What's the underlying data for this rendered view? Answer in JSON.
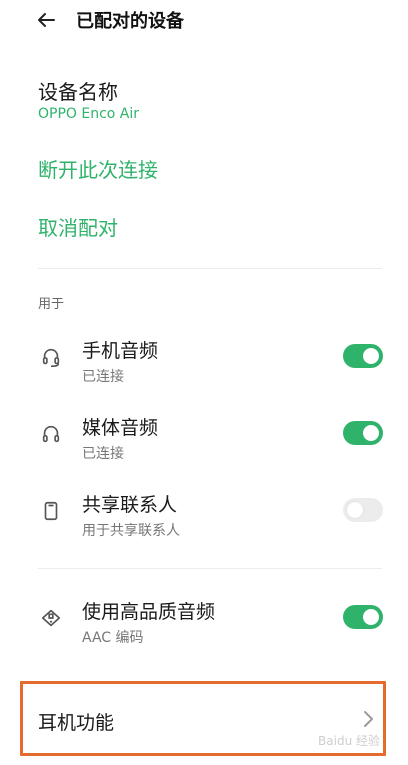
{
  "header": {
    "title": "已配对的设备",
    "back_icon": "arrow-left-icon"
  },
  "device": {
    "label": "设备名称",
    "value": "OPPO Enco Air"
  },
  "actions": {
    "disconnect": "断开此次连接",
    "unpair": "取消配对"
  },
  "section": {
    "label": "用于"
  },
  "rows": [
    {
      "title": "手机音频",
      "subtitle": "已连接",
      "icon": "headset-icon",
      "enabled": true
    },
    {
      "title": "媒体音频",
      "subtitle": "已连接",
      "icon": "headphones-icon",
      "enabled": true
    },
    {
      "title": "共享联系人",
      "subtitle": "用于共享联系人",
      "icon": "phone-icon",
      "enabled": false
    },
    {
      "title": "使用高品质音频",
      "subtitle": "AAC 编码",
      "icon": "hd-audio-icon",
      "enabled": true
    }
  ],
  "earphone_functions": {
    "label": "耳机功能",
    "icon": "chevron-right-icon"
  },
  "watermark": "Baidu 经验",
  "colors": {
    "accent": "#2fb36b",
    "highlight": "#e56a2e",
    "toggle_off": "#ececec"
  }
}
